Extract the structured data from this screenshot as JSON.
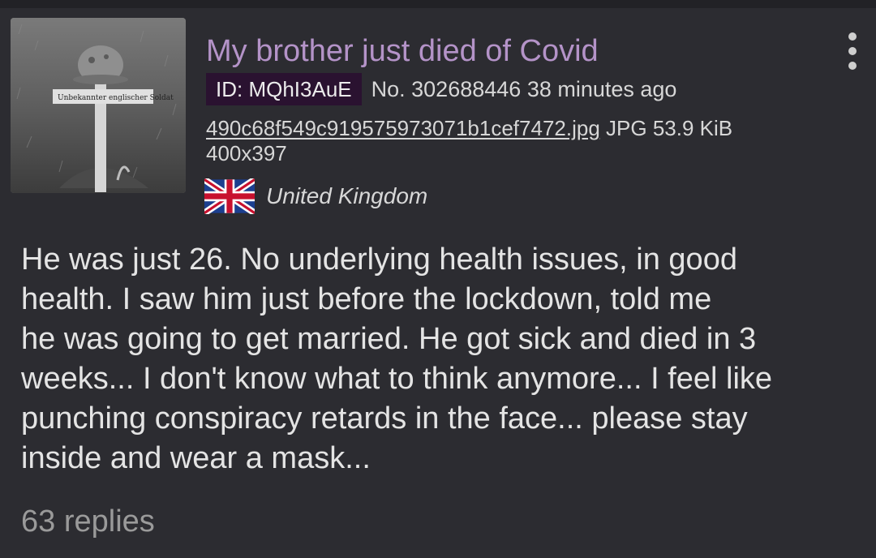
{
  "post": {
    "thumbnail": {
      "alt": "Unbekannter englischer Soldat",
      "sign_text": "Unbekannter englischer Soldat"
    },
    "subject": "My brother just died of Covid",
    "poster_id": "ID: MQhI3AuE",
    "post_number": "No. 302688446",
    "timestamp": "38 minutes ago",
    "file": {
      "name": "490c68f549c919575973071b1cef7472.jpg",
      "type": "JPG",
      "size": "53.9 KiB",
      "dimensions": "400x397"
    },
    "country": {
      "name": "United Kingdom",
      "flag_icon": "uk-flag-icon"
    },
    "comment_lines": [
      "He was just 26. No underlying health issues, in good",
      "health. I saw him just before the lockdown, told me",
      "he was going to get married. He got sick and died in 3",
      "weeks... I don't know what to think anymore... I feel like",
      "punching conspiracy retards in the face... please stay",
      "inside and wear a mask..."
    ],
    "replies": "63 replies"
  },
  "colors": {
    "background": "#2c2c31",
    "subject": "#b493c8",
    "id_badge": "#2a1230",
    "text": "#e2e2e2",
    "replies": "#9a9a9a"
  }
}
